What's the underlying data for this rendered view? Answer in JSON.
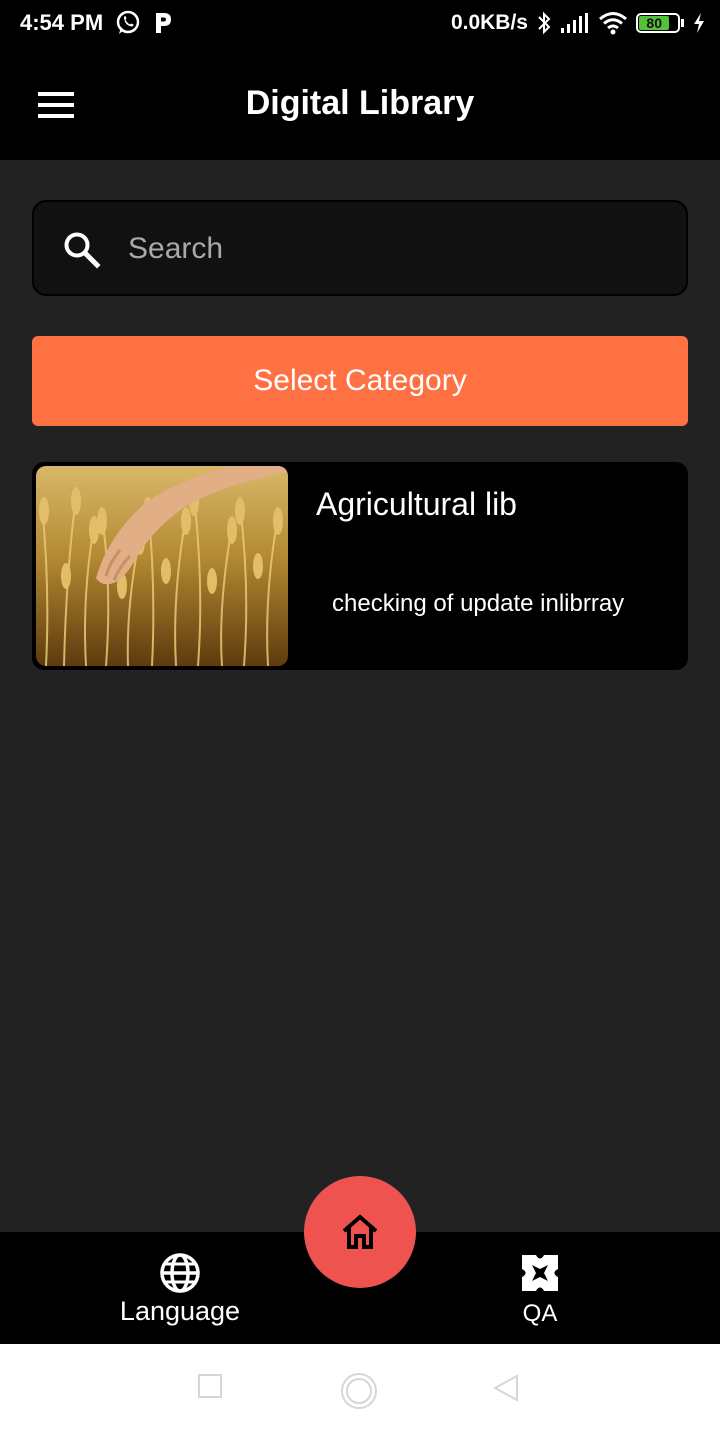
{
  "status_bar": {
    "time": "4:54 PM",
    "notification_icons": [
      "whatsapp-icon",
      "p-app-icon"
    ],
    "network_speed": "0.0KB/s",
    "battery_level": "80",
    "battery_fraction": 0.8,
    "battery_color": "#53c23b"
  },
  "app_bar": {
    "title": "Digital Library"
  },
  "search": {
    "placeholder": "Search",
    "value": ""
  },
  "category_button": {
    "label": "Select Category",
    "color": "#ff7043"
  },
  "library_items": [
    {
      "title": "Agricultural lib",
      "description": "checking of update inlibrray",
      "image": "wheat-field-hand"
    }
  ],
  "bottom_nav": {
    "language_label": "Language",
    "qa_label": "QA",
    "home_icon": "home-icon",
    "home_color": "#ef5350"
  },
  "system_nav": {
    "buttons": [
      "recents",
      "home",
      "back"
    ]
  }
}
